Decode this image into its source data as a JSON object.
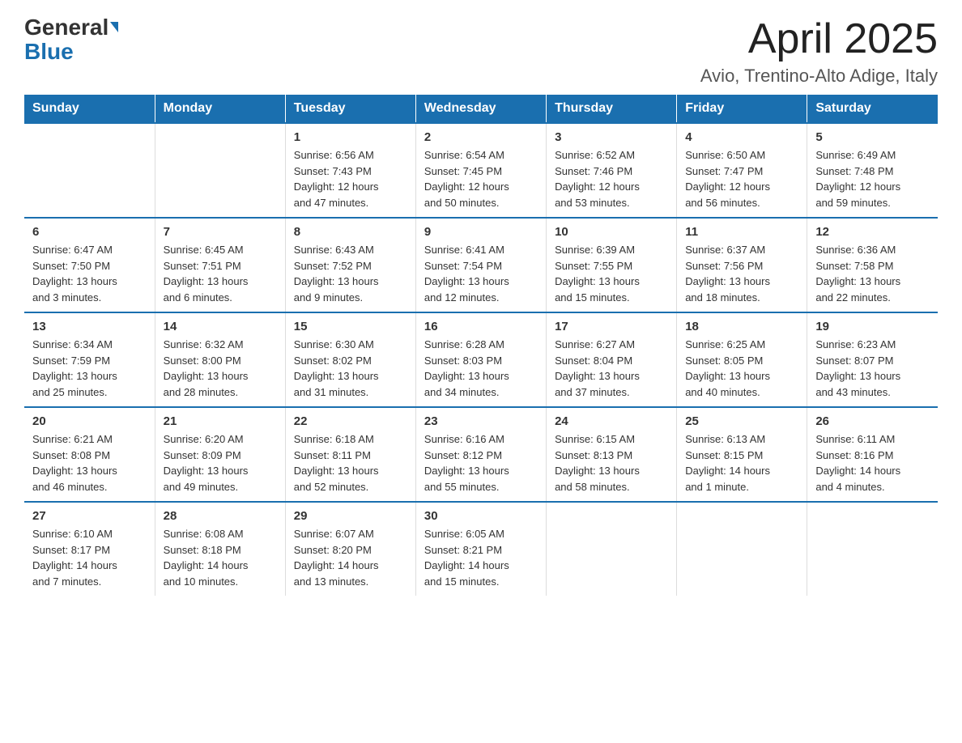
{
  "header": {
    "logo_general": "General",
    "logo_blue": "Blue",
    "title": "April 2025",
    "subtitle": "Avio, Trentino-Alto Adige, Italy"
  },
  "weekdays": [
    "Sunday",
    "Monday",
    "Tuesday",
    "Wednesday",
    "Thursday",
    "Friday",
    "Saturday"
  ],
  "weeks": [
    [
      {
        "day": "",
        "info": ""
      },
      {
        "day": "",
        "info": ""
      },
      {
        "day": "1",
        "info": "Sunrise: 6:56 AM\nSunset: 7:43 PM\nDaylight: 12 hours\nand 47 minutes."
      },
      {
        "day": "2",
        "info": "Sunrise: 6:54 AM\nSunset: 7:45 PM\nDaylight: 12 hours\nand 50 minutes."
      },
      {
        "day": "3",
        "info": "Sunrise: 6:52 AM\nSunset: 7:46 PM\nDaylight: 12 hours\nand 53 minutes."
      },
      {
        "day": "4",
        "info": "Sunrise: 6:50 AM\nSunset: 7:47 PM\nDaylight: 12 hours\nand 56 minutes."
      },
      {
        "day": "5",
        "info": "Sunrise: 6:49 AM\nSunset: 7:48 PM\nDaylight: 12 hours\nand 59 minutes."
      }
    ],
    [
      {
        "day": "6",
        "info": "Sunrise: 6:47 AM\nSunset: 7:50 PM\nDaylight: 13 hours\nand 3 minutes."
      },
      {
        "day": "7",
        "info": "Sunrise: 6:45 AM\nSunset: 7:51 PM\nDaylight: 13 hours\nand 6 minutes."
      },
      {
        "day": "8",
        "info": "Sunrise: 6:43 AM\nSunset: 7:52 PM\nDaylight: 13 hours\nand 9 minutes."
      },
      {
        "day": "9",
        "info": "Sunrise: 6:41 AM\nSunset: 7:54 PM\nDaylight: 13 hours\nand 12 minutes."
      },
      {
        "day": "10",
        "info": "Sunrise: 6:39 AM\nSunset: 7:55 PM\nDaylight: 13 hours\nand 15 minutes."
      },
      {
        "day": "11",
        "info": "Sunrise: 6:37 AM\nSunset: 7:56 PM\nDaylight: 13 hours\nand 18 minutes."
      },
      {
        "day": "12",
        "info": "Sunrise: 6:36 AM\nSunset: 7:58 PM\nDaylight: 13 hours\nand 22 minutes."
      }
    ],
    [
      {
        "day": "13",
        "info": "Sunrise: 6:34 AM\nSunset: 7:59 PM\nDaylight: 13 hours\nand 25 minutes."
      },
      {
        "day": "14",
        "info": "Sunrise: 6:32 AM\nSunset: 8:00 PM\nDaylight: 13 hours\nand 28 minutes."
      },
      {
        "day": "15",
        "info": "Sunrise: 6:30 AM\nSunset: 8:02 PM\nDaylight: 13 hours\nand 31 minutes."
      },
      {
        "day": "16",
        "info": "Sunrise: 6:28 AM\nSunset: 8:03 PM\nDaylight: 13 hours\nand 34 minutes."
      },
      {
        "day": "17",
        "info": "Sunrise: 6:27 AM\nSunset: 8:04 PM\nDaylight: 13 hours\nand 37 minutes."
      },
      {
        "day": "18",
        "info": "Sunrise: 6:25 AM\nSunset: 8:05 PM\nDaylight: 13 hours\nand 40 minutes."
      },
      {
        "day": "19",
        "info": "Sunrise: 6:23 AM\nSunset: 8:07 PM\nDaylight: 13 hours\nand 43 minutes."
      }
    ],
    [
      {
        "day": "20",
        "info": "Sunrise: 6:21 AM\nSunset: 8:08 PM\nDaylight: 13 hours\nand 46 minutes."
      },
      {
        "day": "21",
        "info": "Sunrise: 6:20 AM\nSunset: 8:09 PM\nDaylight: 13 hours\nand 49 minutes."
      },
      {
        "day": "22",
        "info": "Sunrise: 6:18 AM\nSunset: 8:11 PM\nDaylight: 13 hours\nand 52 minutes."
      },
      {
        "day": "23",
        "info": "Sunrise: 6:16 AM\nSunset: 8:12 PM\nDaylight: 13 hours\nand 55 minutes."
      },
      {
        "day": "24",
        "info": "Sunrise: 6:15 AM\nSunset: 8:13 PM\nDaylight: 13 hours\nand 58 minutes."
      },
      {
        "day": "25",
        "info": "Sunrise: 6:13 AM\nSunset: 8:15 PM\nDaylight: 14 hours\nand 1 minute."
      },
      {
        "day": "26",
        "info": "Sunrise: 6:11 AM\nSunset: 8:16 PM\nDaylight: 14 hours\nand 4 minutes."
      }
    ],
    [
      {
        "day": "27",
        "info": "Sunrise: 6:10 AM\nSunset: 8:17 PM\nDaylight: 14 hours\nand 7 minutes."
      },
      {
        "day": "28",
        "info": "Sunrise: 6:08 AM\nSunset: 8:18 PM\nDaylight: 14 hours\nand 10 minutes."
      },
      {
        "day": "29",
        "info": "Sunrise: 6:07 AM\nSunset: 8:20 PM\nDaylight: 14 hours\nand 13 minutes."
      },
      {
        "day": "30",
        "info": "Sunrise: 6:05 AM\nSunset: 8:21 PM\nDaylight: 14 hours\nand 15 minutes."
      },
      {
        "day": "",
        "info": ""
      },
      {
        "day": "",
        "info": ""
      },
      {
        "day": "",
        "info": ""
      }
    ]
  ]
}
